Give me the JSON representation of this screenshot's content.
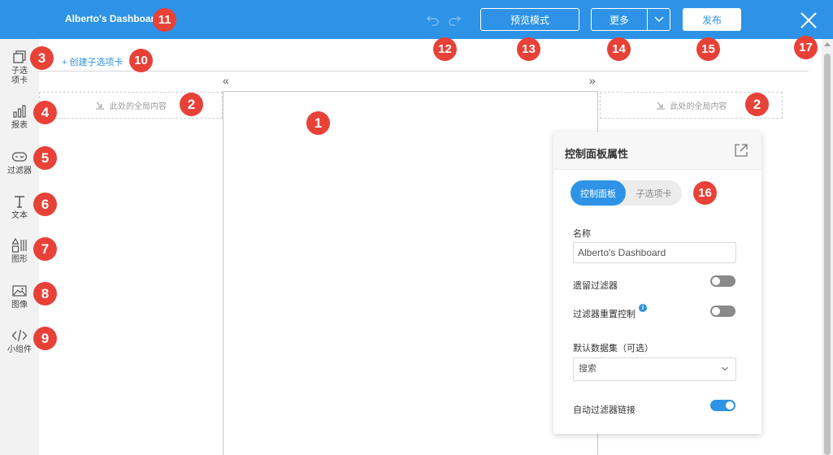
{
  "topbar": {
    "title": "Alberto's Dashboard",
    "preview_label": "预览模式",
    "more_label": "更多",
    "publish_label": "发布"
  },
  "leftbar": {
    "items": [
      {
        "label": "子选项卡",
        "icon": "tab-icon"
      },
      {
        "label": "报表",
        "icon": "bar-chart-icon"
      },
      {
        "label": "过滤器",
        "icon": "filter-icon"
      },
      {
        "label": "文本",
        "icon": "text-icon"
      },
      {
        "label": "图形",
        "icon": "shapes-icon"
      },
      {
        "label": "图像",
        "icon": "image-icon"
      },
      {
        "label": "小组件",
        "icon": "code-icon"
      }
    ]
  },
  "canvas": {
    "create_tab_label": "+ 创建子选项卡",
    "global_left": "此处的全局内容",
    "global_right": "此处的全局内容",
    "chev_left": "«",
    "chev_right": "»"
  },
  "panel": {
    "title": "控制面板属性",
    "tab_dashboard": "控制面板",
    "tab_subtab": "子选项卡",
    "name_label": "名称",
    "name_value": "Alberto's Dashboard",
    "retain_filter_label": "遗留过滤器",
    "retain_filter_on": false,
    "filter_reset_label": "过滤器重置控制",
    "filter_reset_on": false,
    "dataset_label": "默认数据集（可选）",
    "dataset_placeholder": "搜索",
    "auto_link_label": "自动过滤器链接",
    "auto_link_on": true
  },
  "markers": [
    "1",
    "2",
    "2",
    "3",
    "4",
    "5",
    "6",
    "7",
    "8",
    "9",
    "10",
    "11",
    "12",
    "13",
    "14",
    "15",
    "16",
    "17"
  ],
  "colors": {
    "primary": "#2e93e6",
    "marker": "#e84137"
  }
}
